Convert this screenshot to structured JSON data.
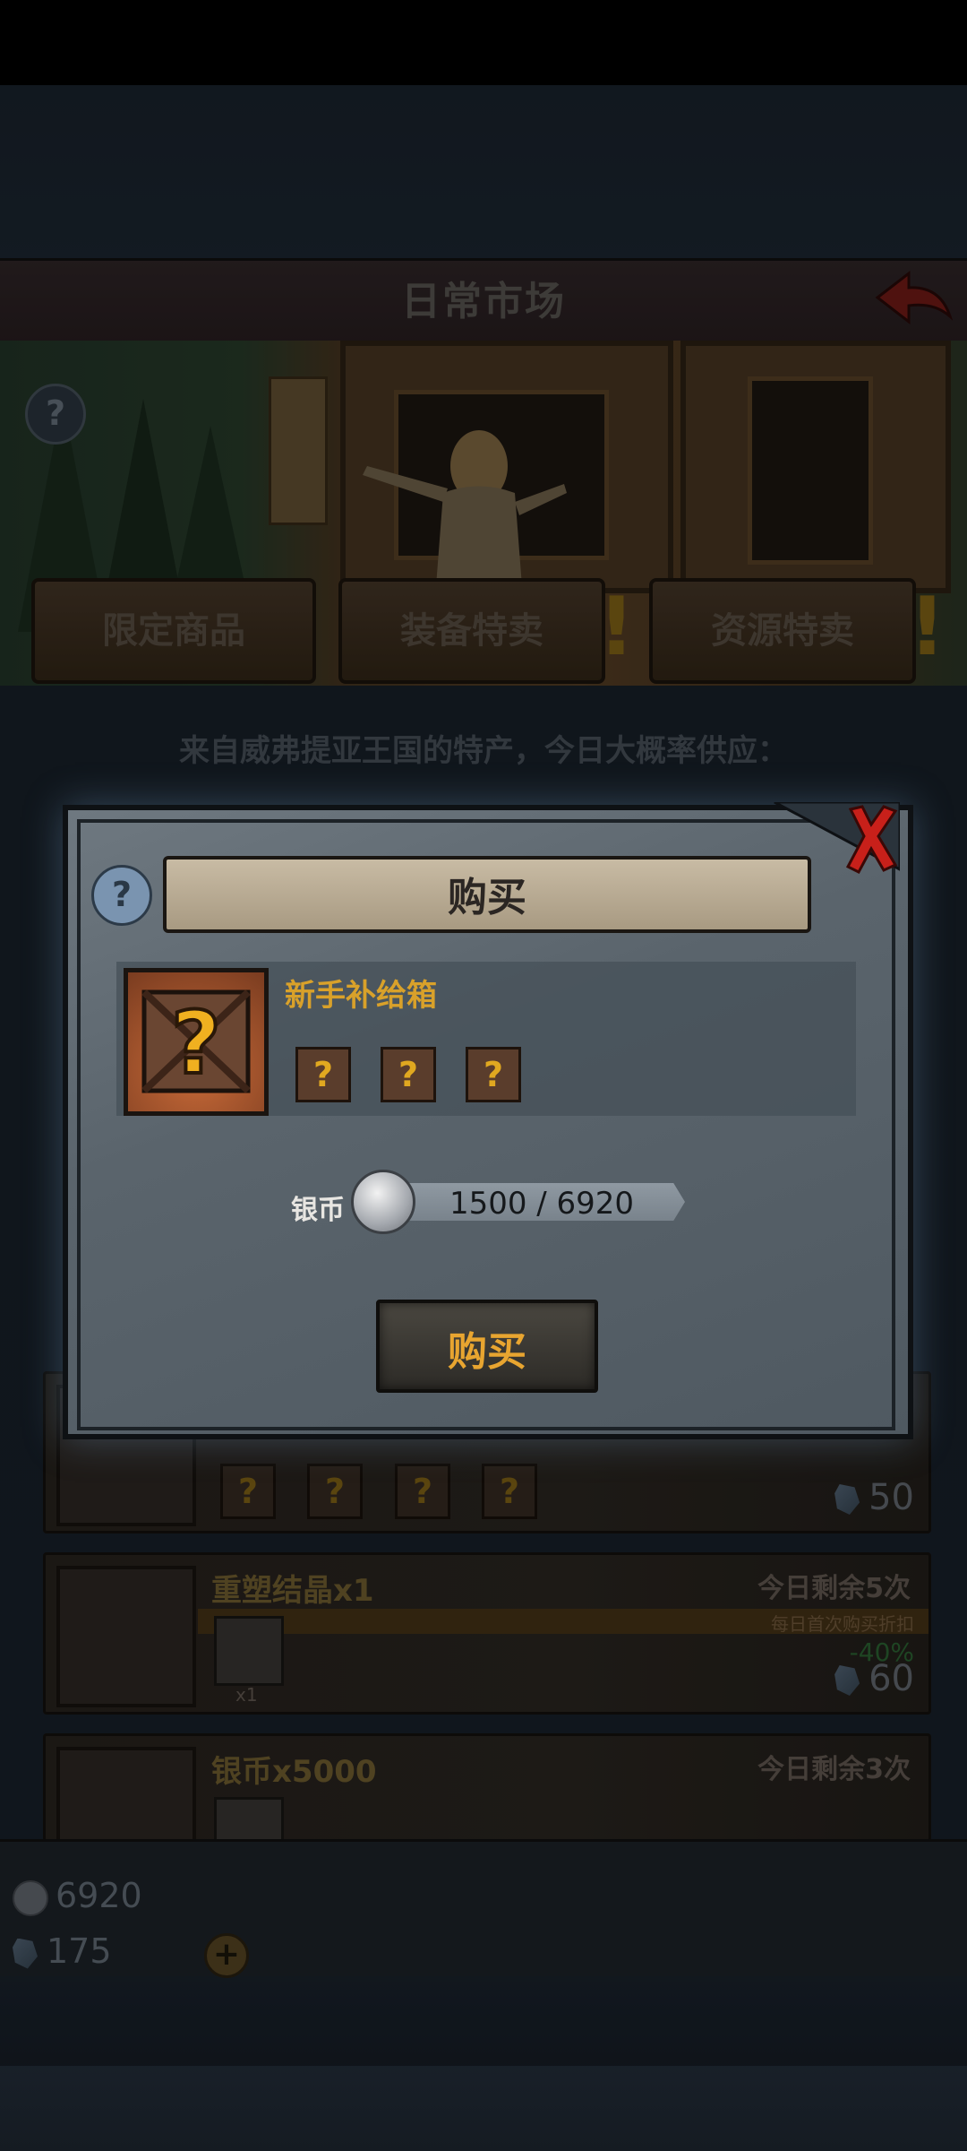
{
  "header": {
    "title": "日常市场"
  },
  "tabs": [
    {
      "label": "限定商品"
    },
    {
      "label": "装备特卖"
    },
    {
      "label": "资源特卖"
    }
  ],
  "subtitle": "来自威弗提亚王国的特产，今日大概率供应：",
  "list": {
    "crate_item": {
      "price": "50"
    },
    "reforge_item": {
      "name": "重塑结晶x1",
      "remaining": "今日剩余5次",
      "discount_note": "每日首次购买折扣",
      "discount": "-40%",
      "qty": "x1",
      "price": "60"
    },
    "silver_item": {
      "name": "银币x5000",
      "remaining": "今日剩余3次"
    }
  },
  "currency": {
    "silver": "6920",
    "crystal": "175"
  },
  "dialog": {
    "title": "购买",
    "product_name": "新手补给箱",
    "cost_label": "银币",
    "cost_value": "1500 / 6920",
    "buy_label": "购买"
  },
  "colors": {
    "accent_gold": "#d9a12a",
    "buy_orange": "#e8a530",
    "close_red": "#c8201a"
  }
}
